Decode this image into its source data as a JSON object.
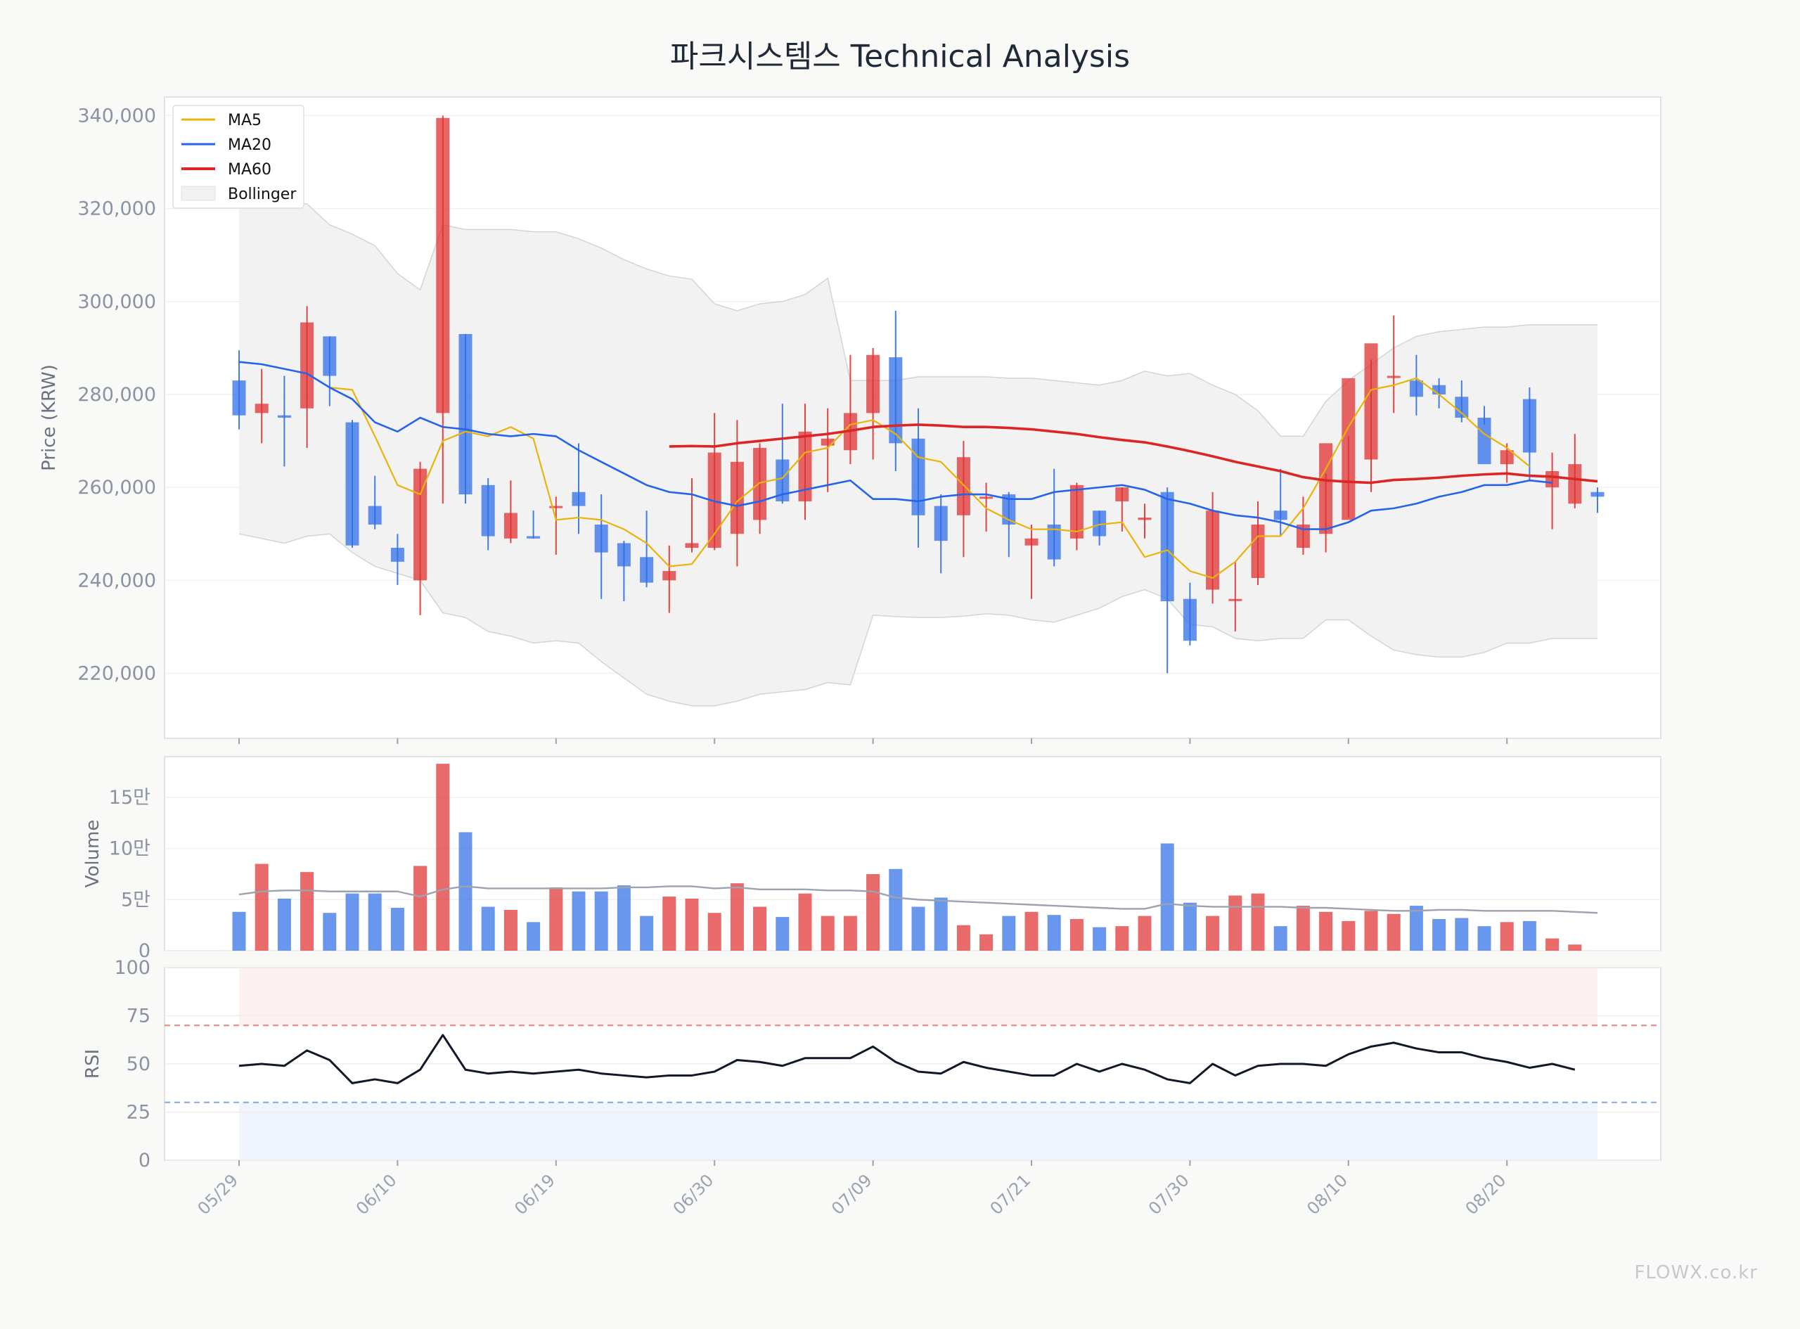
{
  "page": {
    "title": "파크시스템스 Technical Analysis",
    "watermark": "FLOWX.co.kr"
  },
  "colors": {
    "up": "#e03131",
    "down": "#2f6fe8",
    "ma5": "#eab308",
    "ma20": "#2563eb",
    "ma60": "#dc2626",
    "bollinger": "#e7e3e0",
    "volume_ma": "#9ca3af",
    "rsi": "#111827",
    "rsi_overbought_zone": "#fdecec",
    "rsi_oversold_zone": "#eef3fc"
  },
  "chart_data": [
    {
      "panel": "price",
      "type": "candlestick",
      "ylabel": "Price (KRW)",
      "ylim": [
        206000,
        344000
      ],
      "yticks": [
        220000,
        240000,
        260000,
        280000,
        300000,
        320000,
        340000
      ],
      "ytick_labels": [
        "220,000",
        "240,000",
        "260,000",
        "280,000",
        "300,000",
        "320,000",
        "340,000"
      ],
      "grid": true,
      "legend_position": "top-left",
      "legend": [
        "MA5",
        "MA20",
        "MA60",
        "Bollinger"
      ],
      "dates": [
        "05/29",
        "05/30",
        "06/02",
        "06/03",
        "06/04",
        "06/05",
        "06/09",
        "06/10",
        "06/11",
        "06/12",
        "06/13",
        "06/16",
        "06/17",
        "06/18",
        "06/19",
        "06/20",
        "06/23",
        "06/24",
        "06/25",
        "06/26",
        "06/27",
        "06/30",
        "07/01",
        "07/02",
        "07/03",
        "07/04",
        "07/07",
        "07/08",
        "07/09",
        "07/10",
        "07/11",
        "07/14",
        "07/15",
        "07/16",
        "07/17",
        "07/18",
        "07/21",
        "07/22",
        "07/23",
        "07/24",
        "07/25",
        "07/28",
        "07/29",
        "07/30",
        "07/31",
        "08/01",
        "08/04",
        "08/05",
        "08/06",
        "08/07",
        "08/08",
        "08/11",
        "08/12",
        "08/13",
        "08/14",
        "08/18",
        "08/19",
        "08/20",
        "08/21",
        "08/22",
        "08/25"
      ],
      "xtick_labels": [
        "05/29",
        "06/10",
        "06/19",
        "06/30",
        "07/09",
        "07/21",
        "07/30",
        "08/10",
        "08/20"
      ],
      "xtick_indices": [
        0,
        7,
        14,
        21,
        28,
        35,
        42,
        49,
        56
      ],
      "open": [
        283000,
        276000,
        275500,
        277000,
        292500,
        274000,
        256000,
        247000,
        240000,
        276000,
        293000,
        260500,
        249000,
        249500,
        256000,
        259000,
        252000,
        248000,
        245000,
        240000,
        247000,
        247000,
        250000,
        253000,
        266000,
        257000,
        269000,
        268000,
        276000,
        288000,
        270500,
        256000,
        254000,
        258000,
        258500,
        247500,
        252000,
        249000,
        255000,
        257000,
        253000,
        259000,
        236000,
        238000,
        236000,
        240500,
        255000,
        247000,
        250000,
        253000,
        266000,
        284000,
        283000,
        282000,
        279500,
        275000,
        265000,
        279000,
        260000,
        256500,
        259000
      ],
      "high": [
        289500,
        285500,
        284000,
        299000,
        292500,
        274500,
        262500,
        250000,
        265500,
        340000,
        293000,
        262000,
        261500,
        255000,
        258000,
        269500,
        258500,
        248500,
        255000,
        247500,
        262000,
        276000,
        274500,
        269500,
        278000,
        278000,
        277000,
        288500,
        290000,
        298000,
        277000,
        258500,
        270000,
        261000,
        259000,
        252000,
        264000,
        261000,
        255000,
        260000,
        256500,
        260000,
        239500,
        259000,
        244000,
        257000,
        264000,
        258000,
        263000,
        271000,
        287500,
        297000,
        288500,
        283500,
        283000,
        277500,
        269500,
        281500,
        267500,
        271500,
        260000
      ],
      "low": [
        272500,
        269500,
        264500,
        268500,
        277500,
        247000,
        251000,
        239000,
        232500,
        256500,
        256500,
        246500,
        248000,
        249000,
        245500,
        250000,
        236000,
        235500,
        238500,
        233000,
        246000,
        246500,
        243000,
        250000,
        256500,
        253000,
        259000,
        265000,
        266000,
        263500,
        247000,
        241500,
        245000,
        250500,
        245000,
        236000,
        243000,
        246500,
        247500,
        250500,
        249000,
        220000,
        226000,
        235000,
        229000,
        239000,
        249500,
        245500,
        246000,
        253500,
        259000,
        276000,
        275500,
        277000,
        274000,
        273500,
        261000,
        261500,
        251000,
        255500,
        254500
      ],
      "close": [
        275500,
        278000,
        275000,
        295500,
        284000,
        247500,
        252000,
        244000,
        264000,
        339500,
        258500,
        249500,
        254500,
        249000,
        256000,
        256000,
        246000,
        243000,
        239500,
        242000,
        248000,
        267500,
        265500,
        268500,
        257000,
        272000,
        270500,
        276000,
        288500,
        269500,
        254000,
        248500,
        266500,
        258000,
        252000,
        249000,
        244500,
        260500,
        249500,
        260000,
        253500,
        235500,
        227000,
        255000,
        236000,
        252000,
        253000,
        252000,
        269500,
        283500,
        291000,
        284000,
        279500,
        280000,
        275000,
        265000,
        268000,
        267500,
        263500,
        265000,
        258000
      ],
      "ma5": [
        null,
        null,
        null,
        null,
        281500,
        281000,
        271000,
        260500,
        258500,
        270000,
        272000,
        271000,
        273000,
        270500,
        253000,
        253500,
        253000,
        251000,
        248000,
        243000,
        243500,
        250000,
        257000,
        261000,
        262000,
        267500,
        268500,
        273500,
        274500,
        271500,
        266500,
        265500,
        260500,
        255500,
        253000,
        251000,
        251000,
        250500,
        252000,
        252500,
        245000,
        246500,
        242000,
        240500,
        244000,
        249500,
        249500,
        255500,
        264000,
        273000,
        281000,
        282000,
        283500,
        280000,
        276000,
        271500,
        268500,
        264500,
        null,
        null,
        null
      ],
      "ma20": [
        287000,
        286500,
        285500,
        284500,
        281500,
        279000,
        274000,
        272000,
        275000,
        273000,
        272500,
        271500,
        271000,
        271500,
        271000,
        268000,
        265500,
        263000,
        260500,
        259000,
        258500,
        257000,
        256000,
        257000,
        258500,
        259500,
        260500,
        261500,
        257500,
        257500,
        257000,
        258000,
        258500,
        258500,
        257500,
        257500,
        259000,
        259500,
        260000,
        260500,
        259500,
        257500,
        256500,
        255000,
        254000,
        253500,
        252500,
        251000,
        251000,
        252500,
        255000,
        255500,
        256500,
        258000,
        259000,
        260500,
        260500,
        261500,
        261000,
        null,
        null
      ],
      "ma60": [
        null,
        null,
        null,
        null,
        null,
        null,
        null,
        null,
        null,
        null,
        null,
        null,
        null,
        null,
        null,
        null,
        null,
        null,
        null,
        268800,
        268900,
        268800,
        269500,
        270000,
        270500,
        271000,
        271500,
        272200,
        273000,
        273300,
        273500,
        273300,
        273000,
        273000,
        272800,
        272500,
        272000,
        271500,
        270800,
        270200,
        269700,
        268800,
        267800,
        266700,
        265500,
        264500,
        263500,
        262200,
        261500,
        261200,
        261000,
        261600,
        261800,
        262100,
        262500,
        262800,
        263000,
        262500,
        262300,
        261800,
        261300
      ],
      "bb_upper": [
        322000,
        321500,
        321000,
        321000,
        316500,
        314500,
        312000,
        306000,
        302500,
        316500,
        315500,
        315500,
        315500,
        315000,
        315000,
        313500,
        311500,
        309000,
        307000,
        305500,
        304800,
        299500,
        298000,
        299500,
        300000,
        301500,
        305000,
        283000,
        283000,
        283000,
        283800,
        283800,
        283800,
        283800,
        283500,
        283500,
        283000,
        282500,
        282000,
        283000,
        285000,
        284000,
        284500,
        282000,
        280000,
        276500,
        271000,
        271000,
        278500,
        283000,
        286500,
        290000,
        292500,
        293500,
        294000,
        294500,
        294500,
        295000,
        295000,
        295000,
        295000
      ],
      "bb_lower": [
        250000,
        249000,
        248000,
        249500,
        250000,
        246000,
        243000,
        241500,
        240000,
        233000,
        232000,
        229000,
        228000,
        226500,
        227000,
        226500,
        222500,
        219000,
        215500,
        214000,
        213000,
        213000,
        214000,
        215500,
        216000,
        216500,
        218000,
        217500,
        232500,
        232200,
        232000,
        232000,
        232300,
        232800,
        232500,
        231500,
        231000,
        232500,
        234000,
        236500,
        238000,
        236000,
        230500,
        230000,
        227500,
        227000,
        227500,
        227500,
        231500,
        231500,
        228000,
        225000,
        224000,
        223500,
        223500,
        224500,
        226500,
        226500,
        227500,
        227500,
        227500
      ]
    },
    {
      "panel": "volume",
      "type": "bar",
      "ylabel": "Volume",
      "ylim": [
        0,
        19000
      ],
      "yticks": [
        0,
        5000,
        10000,
        15000
      ],
      "ytick_labels": [
        "0",
        "5만",
        "10만",
        "15만"
      ],
      "values": [
        3800,
        8500,
        5100,
        7700,
        3700,
        5600,
        5600,
        4200,
        8300,
        18300,
        11600,
        4300,
        4000,
        2800,
        6200,
        5800,
        5800,
        6400,
        3400,
        5300,
        5100,
        3700,
        6600,
        4300,
        3300,
        5600,
        3400,
        3400,
        7500,
        8000,
        4300,
        5200,
        2500,
        1600,
        3400,
        3800,
        3500,
        3100,
        2300,
        2400,
        3400,
        10500,
        4700,
        3400,
        5400,
        5600,
        2400,
        4400,
        3800,
        2900,
        3900,
        3600,
        4400,
        3100,
        3200,
        2400,
        2800,
        2900,
        1200,
        600,
        null
      ],
      "ma": [
        5500,
        5800,
        5900,
        5900,
        5800,
        5800,
        5800,
        5800,
        5300,
        6000,
        6300,
        6100,
        6100,
        6100,
        6100,
        6100,
        6100,
        6200,
        6200,
        6300,
        6300,
        6100,
        6200,
        6000,
        6000,
        6000,
        5900,
        5900,
        5800,
        5200,
        5000,
        4900,
        4800,
        4700,
        4600,
        4500,
        4400,
        4300,
        4200,
        4100,
        4100,
        4600,
        4400,
        4300,
        4300,
        4300,
        4300,
        4200,
        4200,
        4100,
        4000,
        3900,
        3900,
        4000,
        4000,
        3900,
        3900,
        3900,
        3900,
        3800,
        3700
      ]
    },
    {
      "panel": "rsi",
      "type": "line",
      "ylabel": "RSI",
      "ylim": [
        0,
        100
      ],
      "yticks": [
        0,
        25,
        50,
        75,
        100
      ],
      "ytick_labels": [
        "0",
        "25",
        "50",
        "75",
        "100"
      ],
      "overbought": 70,
      "oversold": 30,
      "values": [
        49,
        50,
        49,
        57,
        52,
        40,
        42,
        40,
        47,
        65,
        47,
        45,
        46,
        45,
        46,
        47,
        45,
        44,
        43,
        44,
        44,
        46,
        52,
        51,
        49,
        53,
        53,
        53,
        59,
        51,
        46,
        45,
        51,
        48,
        46,
        44,
        44,
        50,
        46,
        50,
        47,
        42,
        40,
        50,
        44,
        49,
        50,
        50,
        49,
        55,
        59,
        61,
        58,
        56,
        56,
        53,
        51,
        48,
        50,
        47,
        null
      ]
    }
  ]
}
